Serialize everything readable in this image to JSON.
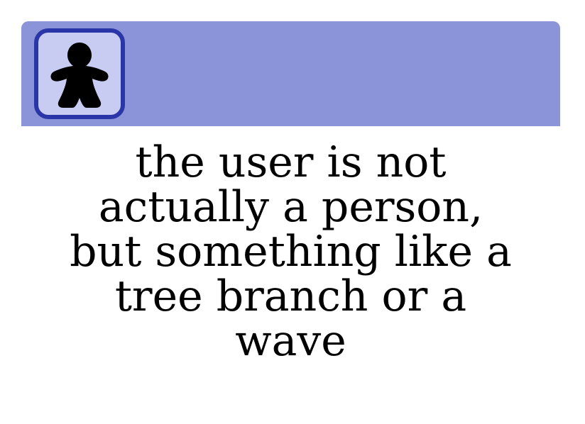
{
  "card": {
    "accent_color": "#8b93d9",
    "avatar_border_color": "#2a35a8",
    "avatar_fill_color": "#c8ccf3",
    "avatar_icon": "meeple-person-icon",
    "lines": [
      "the user is not",
      "actually a person,",
      "but something like a",
      "tree branch or a",
      "wave"
    ]
  }
}
